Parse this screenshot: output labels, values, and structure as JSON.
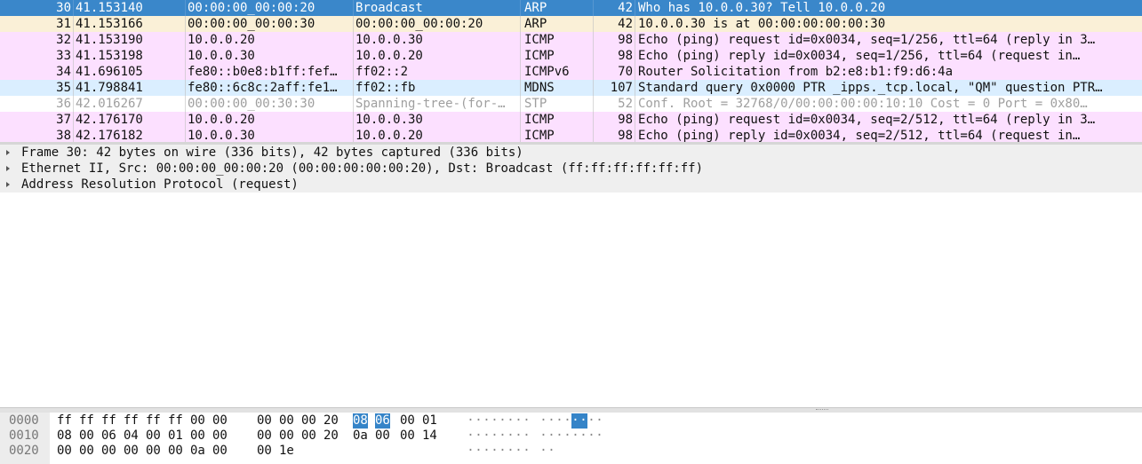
{
  "colors": {
    "selected": "#3a87ca",
    "arp": "#faf0d7",
    "icmp": "#fce0ff",
    "udp": "#daeeff",
    "stp": "#ffffff",
    "selected_text": "#ffffff",
    "stp_text": "#9f9f9f"
  },
  "packets": [
    {
      "no": "30",
      "time": "41.153140",
      "src": "00:00:00_00:00:20",
      "dst": "Broadcast",
      "proto": "ARP",
      "len": "42",
      "info": "Who has 10.0.0.30? Tell 10.0.0.20",
      "color": "selected"
    },
    {
      "no": "31",
      "time": "41.153166",
      "src": "00:00:00_00:00:30",
      "dst": "00:00:00_00:00:20",
      "proto": "ARP",
      "len": "42",
      "info": "10.0.0.30 is at 00:00:00:00:00:30",
      "color": "arp"
    },
    {
      "no": "32",
      "time": "41.153190",
      "src": "10.0.0.20",
      "dst": "10.0.0.30",
      "proto": "ICMP",
      "len": "98",
      "info": "Echo (ping) request  id=0x0034, seq=1/256, ttl=64 (reply in 3…",
      "color": "icmp"
    },
    {
      "no": "33",
      "time": "41.153198",
      "src": "10.0.0.30",
      "dst": "10.0.0.20",
      "proto": "ICMP",
      "len": "98",
      "info": "Echo (ping) reply    id=0x0034, seq=1/256, ttl=64 (request in…",
      "color": "icmp"
    },
    {
      "no": "34",
      "time": "41.696105",
      "src": "fe80::b0e8:b1ff:fef…",
      "dst": "ff02::2",
      "proto": "ICMPv6",
      "len": "70",
      "info": "Router Solicitation from b2:e8:b1:f9:d6:4a",
      "color": "icmp"
    },
    {
      "no": "35",
      "time": "41.798841",
      "src": "fe80::6c8c:2aff:fe1…",
      "dst": "ff02::fb",
      "proto": "MDNS",
      "len": "107",
      "info": "Standard query 0x0000 PTR _ipps._tcp.local, \"QM\" question PTR…",
      "color": "udp"
    },
    {
      "no": "36",
      "time": "42.016267",
      "src": "00:00:00_00:30:30",
      "dst": "Spanning-tree-(for-…",
      "proto": "STP",
      "len": "52",
      "info": "Conf. Root = 32768/0/00:00:00:00:10:10  Cost = 0  Port = 0x80…",
      "color": "stp"
    },
    {
      "no": "37",
      "time": "42.176170",
      "src": "10.0.0.20",
      "dst": "10.0.0.30",
      "proto": "ICMP",
      "len": "98",
      "info": "Echo (ping) request  id=0x0034, seq=2/512, ttl=64 (reply in 3…",
      "color": "icmp"
    },
    {
      "no": "38",
      "time": "42.176182",
      "src": "10.0.0.30",
      "dst": "10.0.0.20",
      "proto": "ICMP",
      "len": "98",
      "info": "Echo (ping) reply    id=0x0034, seq=2/512, ttl=64 (request in…",
      "color": "icmp"
    }
  ],
  "details": [
    "Frame 30: 42 bytes on wire (336 bits), 42 bytes captured (336 bits)",
    "Ethernet II, Src: 00:00:00_00:00:20 (00:00:00:00:00:20), Dst: Broadcast (ff:ff:ff:ff:ff:ff)",
    "Address Resolution Protocol (request)"
  ],
  "bytes": [
    {
      "offset": "0000",
      "hex": [
        "ff",
        "ff",
        "ff",
        "ff",
        "ff",
        "ff",
        "00",
        "00",
        "00",
        "00",
        "00",
        "20",
        "08",
        "06",
        "00",
        "01"
      ],
      "ascii": "········ ········"
    },
    {
      "offset": "0010",
      "hex": [
        "08",
        "00",
        "06",
        "04",
        "00",
        "01",
        "00",
        "00",
        "00",
        "00",
        "00",
        "20",
        "0a",
        "00",
        "00",
        "14"
      ],
      "ascii": "········ ········"
    },
    {
      "offset": "0020",
      "hex": [
        "00",
        "00",
        "00",
        "00",
        "00",
        "00",
        "0a",
        "00",
        "00",
        "1e"
      ],
      "ascii": "········ ··"
    }
  ],
  "selected_bytes": [
    12,
    13
  ]
}
